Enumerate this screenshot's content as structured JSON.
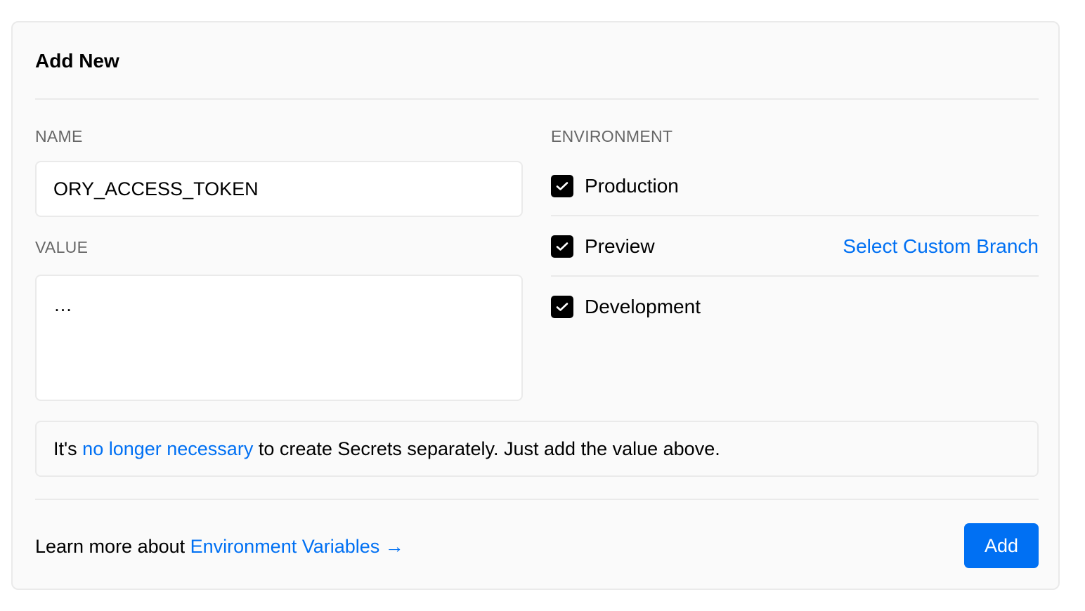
{
  "card": {
    "title": "Add New"
  },
  "form": {
    "name_label": "NAME",
    "name_value": "ORY_ACCESS_TOKEN",
    "value_label": "VALUE",
    "value_value": "…"
  },
  "environment": {
    "label": "ENVIRONMENT",
    "options": [
      {
        "label": "Production",
        "checked": true
      },
      {
        "label": "Preview",
        "checked": true
      },
      {
        "label": "Development",
        "checked": true
      }
    ],
    "custom_branch_link": "Select Custom Branch"
  },
  "notice": {
    "prefix": "It's ",
    "link": "no longer necessary",
    "suffix": " to create Secrets separately. Just add the value above."
  },
  "footer": {
    "prefix": "Learn more about ",
    "link": "Environment Variables →",
    "add_button": "Add"
  },
  "colors": {
    "accent": "#0070f3",
    "card_background": "#fafafa",
    "border": "#eaeaea",
    "label": "#666666"
  },
  "icons": {
    "checkbox": "check-icon"
  }
}
